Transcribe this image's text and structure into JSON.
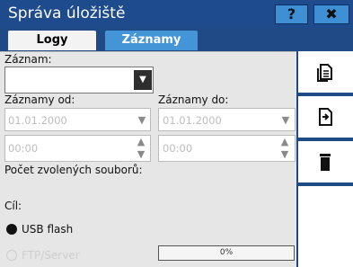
{
  "window": {
    "title": "Správa úložiště"
  },
  "titlebar": {
    "help_label": "?",
    "close_label": "✖"
  },
  "tabs": [
    {
      "label": "Logy",
      "active": false
    },
    {
      "label": "Záznamy",
      "active": true
    }
  ],
  "record": {
    "label": "Záznam:",
    "value": ""
  },
  "from": {
    "label": "Záznamy od:",
    "date": "01.01.2000",
    "time": "00:00"
  },
  "to": {
    "label": "Záznamy do:",
    "date": "01.01.2000",
    "time": "00:00"
  },
  "count": {
    "label": "Počet zvolených souborů:"
  },
  "target": {
    "label": "Cíl:",
    "options": [
      {
        "label": "USB flash",
        "selected": true,
        "enabled": true
      },
      {
        "label": "FTP/Server",
        "selected": false,
        "enabled": false
      }
    ]
  },
  "progress": {
    "text": "0%",
    "value": 0
  },
  "side_buttons": [
    {
      "icon": "copy-icon"
    },
    {
      "icon": "export-icon"
    },
    {
      "icon": "trash-icon"
    }
  ],
  "colors": {
    "titlebar": "#1e4b8c",
    "accent": "#4395d8",
    "panel": "#e6e6e6"
  }
}
